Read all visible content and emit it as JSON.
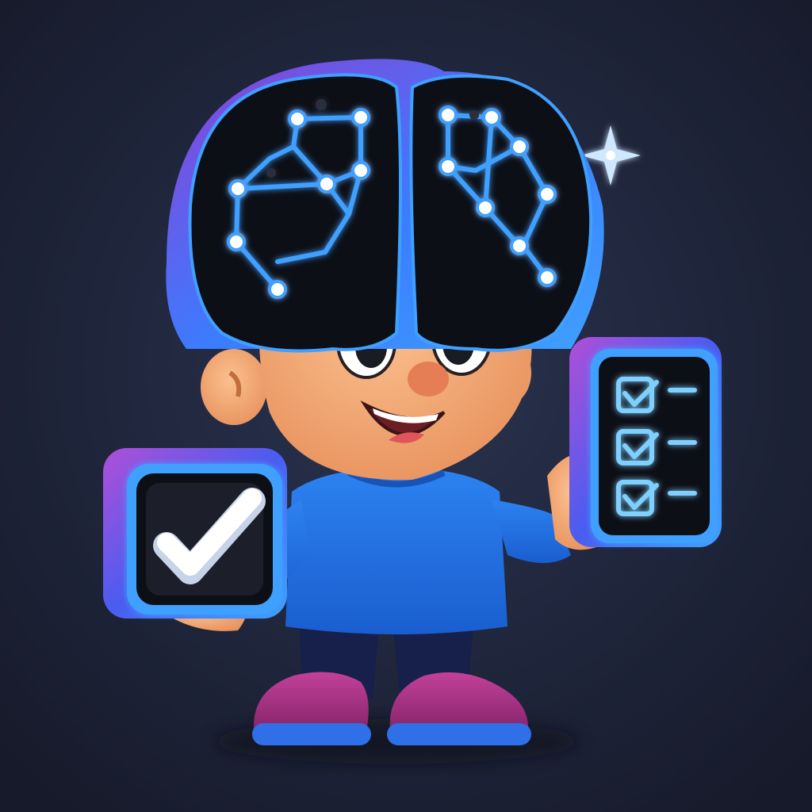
{
  "illustration": {
    "subject": "mascot-character",
    "icons": {
      "brain": "neural-network-brain-icon",
      "single_check": "checkmark-icon",
      "checklist": "checklist-icon",
      "sparkle": "sparkle-icon"
    },
    "checklist": {
      "checked_rows": 3
    }
  },
  "colors": {
    "background_center": "#2a3350",
    "background_edge": "#161a2a",
    "neon_blue": "#3fa0ff",
    "neon_cyan": "#7fd0ff",
    "shirt_blue": "#1f6fe0",
    "shoe_magenta": "#a8307e",
    "skin": "#f2a574",
    "brain_shell": "#0d0f16",
    "frame_purple": "#8d3fd6",
    "white": "#ffffff"
  }
}
